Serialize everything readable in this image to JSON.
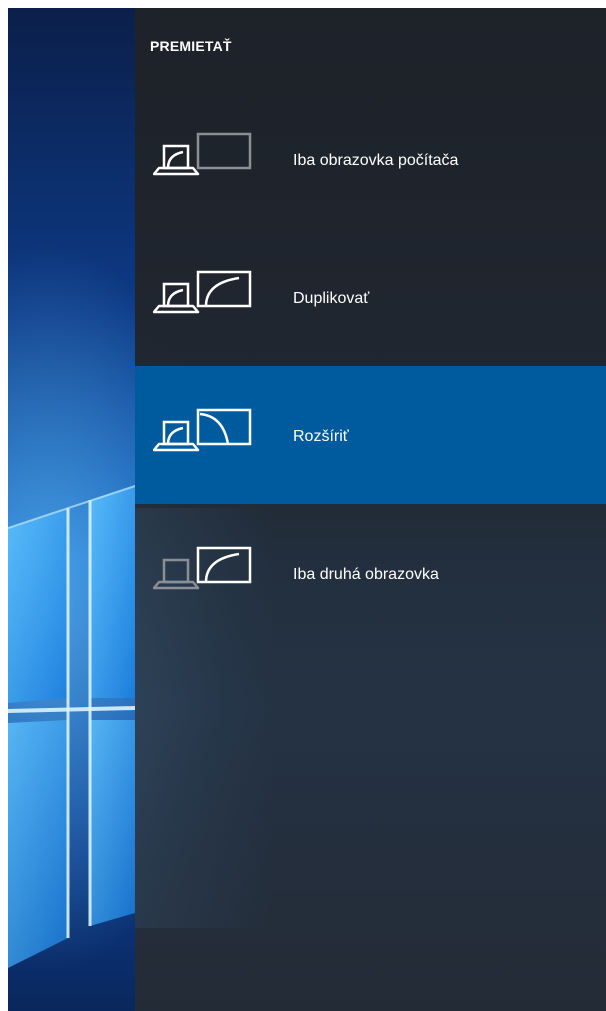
{
  "project_panel": {
    "title": "PREMIETAŤ",
    "options": [
      {
        "label": "Iba obrazovka počítača",
        "selected": false
      },
      {
        "label": "Duplikovať",
        "selected": false
      },
      {
        "label": "Rozšíriť",
        "selected": true
      },
      {
        "label": "Iba druhá obrazovka",
        "selected": false
      }
    ]
  },
  "colors": {
    "panel_bg": "#1e2228",
    "selected_bg": "#005a9e",
    "text": "#ffffff",
    "dim_icon": "#8a8f95"
  }
}
